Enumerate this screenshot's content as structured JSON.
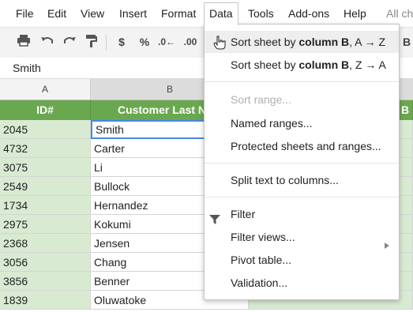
{
  "menubar": {
    "items": [
      "File",
      "Edit",
      "View",
      "Insert",
      "Format",
      "Data",
      "Tools",
      "Add-ons",
      "Help",
      "All ch"
    ]
  },
  "toolbar": {
    "currency": "$",
    "percent": "%",
    "decrease_decimal": ".0←",
    "increase_decimal": ".00",
    "bold": "B"
  },
  "formula_bar": {
    "value": "Smith"
  },
  "columns": [
    "A",
    "B"
  ],
  "header_row": {
    "col_a": "ID#",
    "col_b": "Customer Last Na"
  },
  "rows": [
    {
      "id": "2045",
      "last_name": "Smith"
    },
    {
      "id": "4732",
      "last_name": "Carter"
    },
    {
      "id": "3075",
      "last_name": "Li"
    },
    {
      "id": "2549",
      "last_name": "Bullock"
    },
    {
      "id": "1734",
      "last_name": "Hernandez"
    },
    {
      "id": "2975",
      "last_name": "Kokumi"
    },
    {
      "id": "2368",
      "last_name": "Jensen"
    },
    {
      "id": "3056",
      "last_name": "Chang"
    },
    {
      "id": "3856",
      "last_name": "Benner"
    },
    {
      "id": "1839",
      "last_name": "Oluwatoke"
    }
  ],
  "data_menu": {
    "sort_az": {
      "pre": "Sort sheet by ",
      "bold": "column B",
      "post": ", A → Z"
    },
    "sort_za": {
      "pre": "Sort sheet by ",
      "bold": "column B",
      "post": ", Z → A"
    },
    "sort_range": "Sort range...",
    "named_ranges": "Named ranges...",
    "protected": "Protected sheets and ranges...",
    "split_text": "Split text to columns...",
    "filter": "Filter",
    "filter_views": "Filter views...",
    "pivot_table": "Pivot table...",
    "validation": "Validation..."
  },
  "colors": {
    "header_green": "#6aa84f",
    "light_green": "#d9ead3",
    "selection_blue": "#4a86e8"
  }
}
